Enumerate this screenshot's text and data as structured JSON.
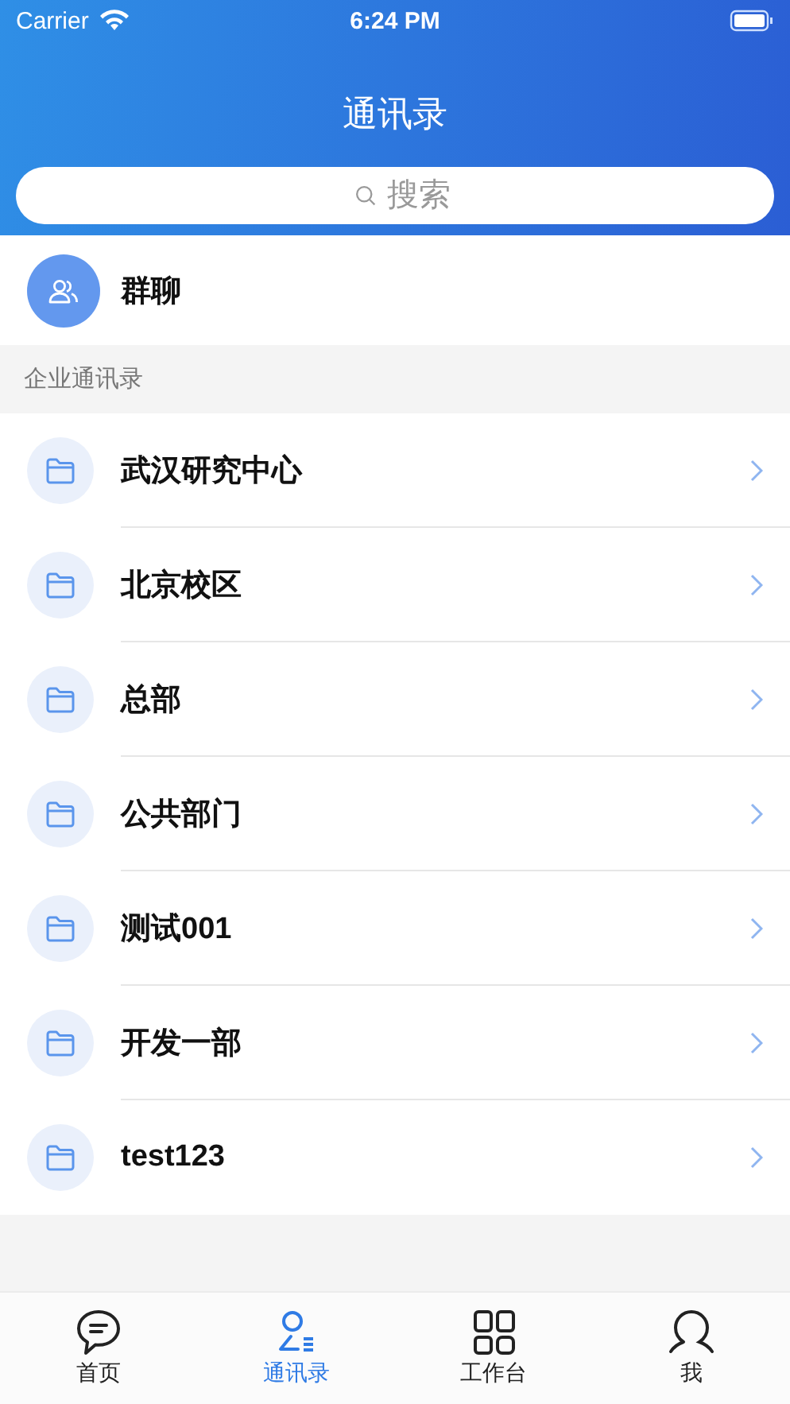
{
  "status_bar": {
    "carrier": "Carrier",
    "time": "6:24 PM"
  },
  "header": {
    "title": "通讯录",
    "search": {
      "placeholder": "搜索"
    }
  },
  "group_chat": {
    "label": "群聊"
  },
  "section": {
    "title": "企业通讯录"
  },
  "departments": [
    {
      "name": "武汉研究中心"
    },
    {
      "name": "北京校区"
    },
    {
      "name": "总部"
    },
    {
      "name": "公共部门"
    },
    {
      "name": "测试001"
    },
    {
      "name": "开发一部"
    },
    {
      "name": "test123"
    }
  ],
  "tab_bar": [
    {
      "label": "首页",
      "kind": "chat",
      "selected": false
    },
    {
      "label": "通讯录",
      "kind": "contacts",
      "selected": true
    },
    {
      "label": "工作台",
      "kind": "grid",
      "selected": false
    },
    {
      "label": "我",
      "kind": "profile",
      "selected": false
    }
  ]
}
